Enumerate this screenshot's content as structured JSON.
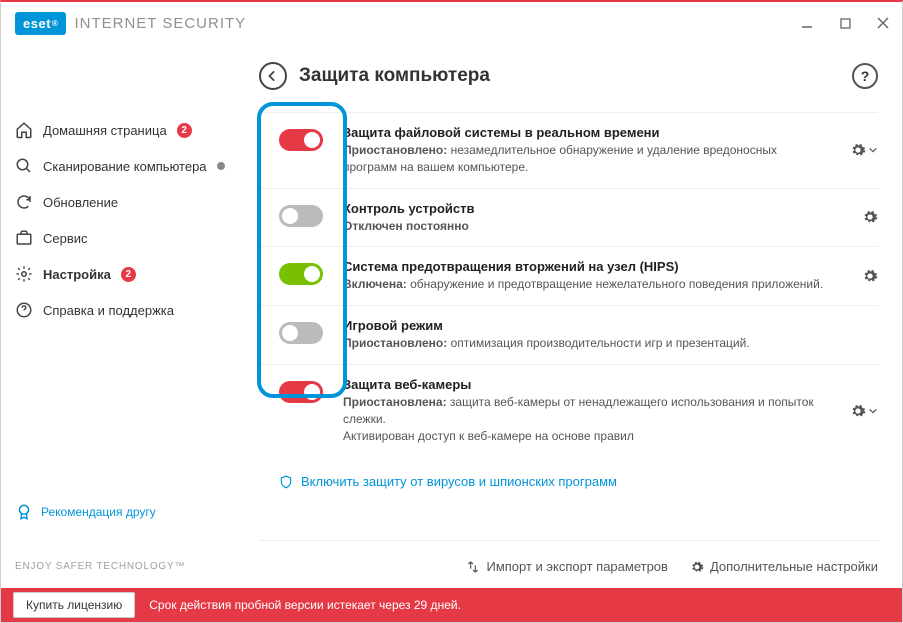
{
  "product": {
    "brand": "eset",
    "name": "INTERNET SECURITY",
    "reg": "®"
  },
  "sidebar": {
    "items": [
      {
        "label": "Домашняя страница",
        "badge": "2"
      },
      {
        "label": "Сканирование компьютера"
      },
      {
        "label": "Обновление"
      },
      {
        "label": "Сервис"
      },
      {
        "label": "Настройка",
        "badge": "2"
      },
      {
        "label": "Справка и поддержка"
      }
    ],
    "recommend": "Рекомендация другу",
    "enjoy": "ENJOY SAFER TECHNOLOGY™"
  },
  "page": {
    "title": "Защита компьютера"
  },
  "settings": [
    {
      "title": "Защита файловой системы в реальном времени",
      "status": "Приостановлено:",
      "desc": " незамедлительное обнаружение и удаление вредоносных программ на вашем компьютере.",
      "state": "red",
      "gear": true,
      "chevron": true
    },
    {
      "title": "Контроль устройств",
      "status": "Отключен постоянно",
      "desc": "",
      "state": "gray",
      "gear": true
    },
    {
      "title": "Система предотвращения вторжений на узел (HIPS)",
      "status": "Включена:",
      "desc": " обнаружение и предотвращение нежелательного поведения приложений.",
      "state": "green",
      "gear": true
    },
    {
      "title": "Игровой режим",
      "status": "Приостановлено:",
      "desc": " оптимизация производительности игр и презентаций.",
      "state": "gray",
      "gear": false
    },
    {
      "title": "Защита веб-камеры",
      "status": "Приостановлена:",
      "desc": " защита веб-камеры от ненадлежащего использования и попыток слежки.",
      "extra": "Активирован доступ к веб-камере на основе правил",
      "state": "red",
      "gear": true,
      "chevron": true
    }
  ],
  "enable_link": "Включить защиту от вирусов и шпионских программ",
  "footer": {
    "import": "Импорт и экспорт параметров",
    "advanced": "Дополнительные настройки"
  },
  "bottombar": {
    "buy": "Купить лицензию",
    "trial": "Срок действия пробной версии истекает через 29 дней."
  }
}
